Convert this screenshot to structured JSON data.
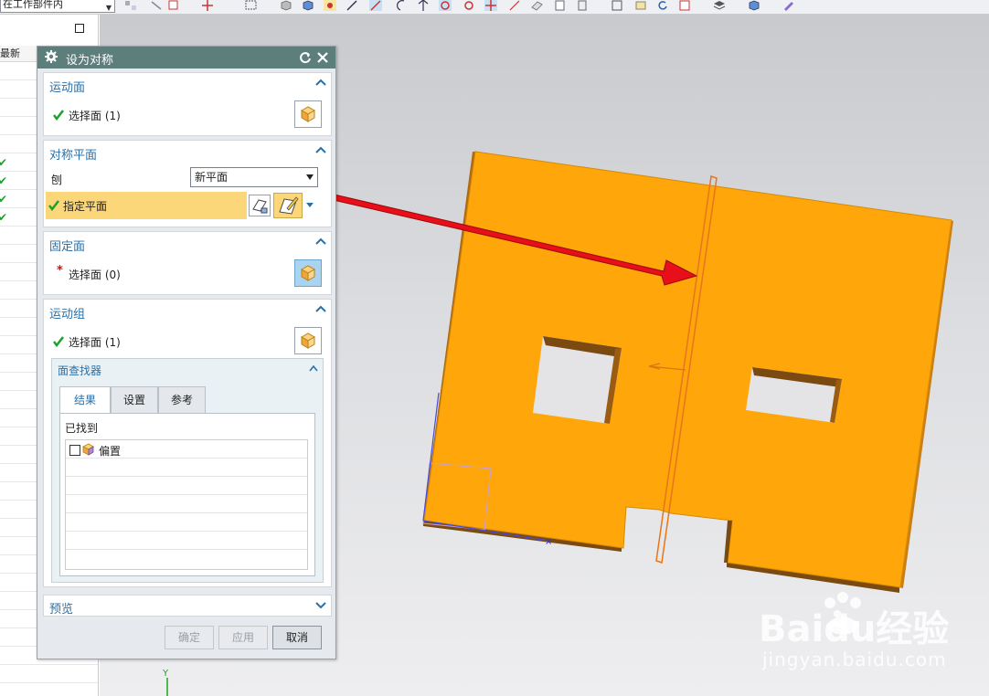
{
  "toolbar": {
    "filter_value": "在工作部件内"
  },
  "navigator": {
    "header": "最新"
  },
  "dialog": {
    "title": "设为对称",
    "sections": {
      "moving_face": {
        "title": "运动面",
        "select_label": "选择面 (1)"
      },
      "symmetry_plane": {
        "title": "对称平面",
        "create_label": "刨",
        "create_value": "新平面",
        "specify_label": "指定平面"
      },
      "stationary_face": {
        "title": "固定面",
        "select_label": "选择面 (0)"
      },
      "motion_group": {
        "title": "运动组",
        "select_label": "选择面 (1)"
      },
      "face_finder": {
        "title": "面查找器",
        "tabs": [
          "结果",
          "设置",
          "参考"
        ],
        "found_label": "已找到",
        "items": [
          "偏置"
        ]
      },
      "preview": {
        "title": "预览"
      }
    },
    "buttons": {
      "ok": "确定",
      "apply": "应用",
      "cancel": "取消"
    }
  },
  "viewport": {
    "axis_label": "Y"
  },
  "watermark": {
    "brand": "Baidu经验",
    "url": "jingyan.baidu.com"
  },
  "colors": {
    "title_bar": "#5d7f7b",
    "section_title": "#2a70a8",
    "part_face": "#ffa60a",
    "arrow": "#e80f1a",
    "highlight_row": "#fcd77a"
  }
}
